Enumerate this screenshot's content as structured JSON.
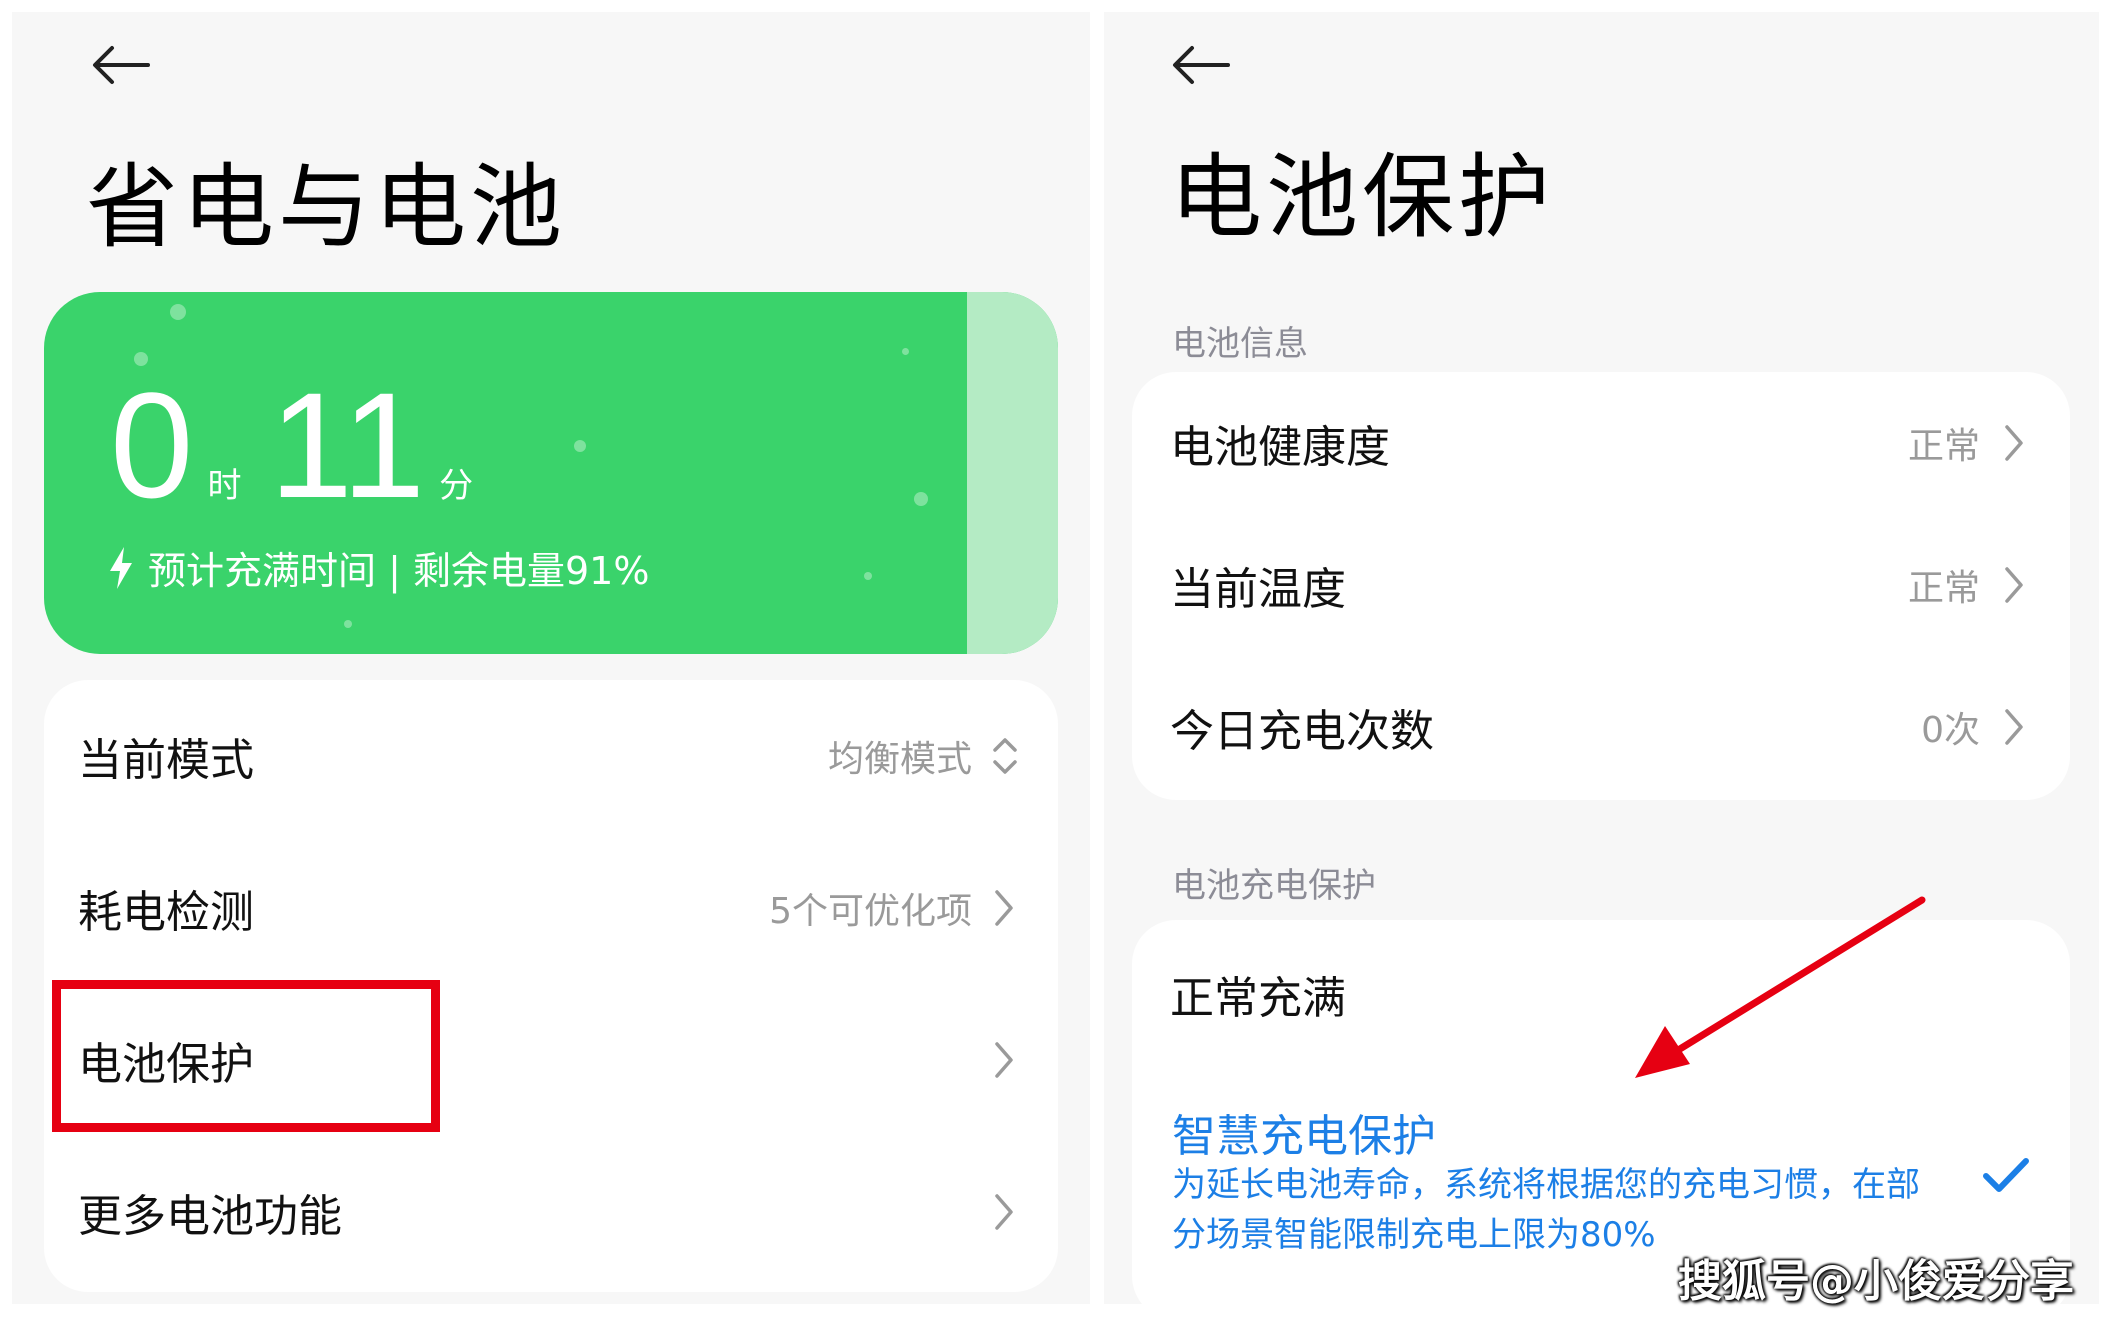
{
  "left_screen": {
    "title": "省电与电池",
    "battery_card": {
      "hours": "0",
      "hours_unit": "时",
      "minutes": "11",
      "minutes_unit": "分",
      "charge_info": "预计充满时间 | 剩余电量91%",
      "battery_level": 0.91,
      "color_fill": "#3ad36b",
      "color_empty": "#b4ebc4"
    },
    "settings": [
      {
        "label": "当前模式",
        "value": "均衡模式"
      },
      {
        "label": "耗电检测",
        "value": "5个可优化项"
      },
      {
        "label": "电池保护",
        "value": ""
      },
      {
        "label": "更多电池功能",
        "value": ""
      }
    ],
    "highlight_color": "#e60012"
  },
  "right_screen": {
    "title": "电池保护",
    "battery_info_section": "电池信息",
    "battery_info": [
      {
        "label": "电池健康度",
        "value": "正常"
      },
      {
        "label": "当前温度",
        "value": "正常"
      },
      {
        "label": "今日充电次数",
        "value": "0次"
      }
    ],
    "charge_protection_section": "电池充电保护",
    "normal_full": "正常充满",
    "smart_protection": {
      "title": "智慧充电保护",
      "description": "为延长电池寿命，系统将根据您的充电习惯，在部分场景智能限制充电上限为80%",
      "selected": true,
      "accent_color": "#1c7fe6"
    },
    "arrow_color": "#e60012"
  },
  "watermark": "搜狐号@小俊爱分享",
  "icons": {
    "back": "back-arrow-icon",
    "chevron": "chevron-right-icon",
    "updown": "chevron-updown-icon",
    "bolt": "lightning-bolt-icon",
    "check": "checkmark-icon"
  }
}
